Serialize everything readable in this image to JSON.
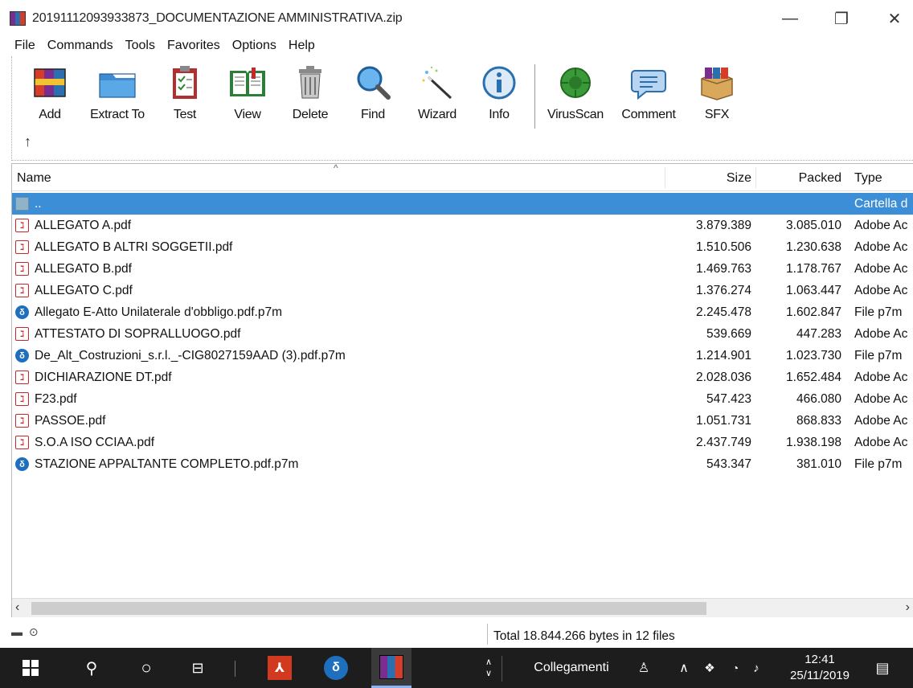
{
  "window": {
    "title": "20191112093933873_DOCUMENTAZIONE AMMINISTRATIVA.zip",
    "min_glyph": "—",
    "max_glyph": "❐",
    "close_glyph": "✕"
  },
  "menu": [
    "File",
    "Commands",
    "Tools",
    "Favorites",
    "Options",
    "Help"
  ],
  "toolbar": {
    "add": "Add",
    "extract": "Extract To",
    "test": "Test",
    "view": "View",
    "delete": "Delete",
    "find": "Find",
    "wizard": "Wizard",
    "info": "Info",
    "virusscan": "VirusScan",
    "comment": "Comment",
    "sfx": "SFX",
    "up_glyph": "↑"
  },
  "columns": {
    "name": "Name",
    "size": "Size",
    "packed": "Packed",
    "type": "Type"
  },
  "rows": [
    {
      "icon": "folder-up-icon",
      "name": "..",
      "size": "",
      "packed": "",
      "type": "Cartella d"
    },
    {
      "icon": "pdf-icon",
      "name": "ALLEGATO A.pdf",
      "size": "3.879.389",
      "packed": "3.085.010",
      "type": "Adobe Ac"
    },
    {
      "icon": "pdf-icon",
      "name": "ALLEGATO B ALTRI SOGGETII.pdf",
      "size": "1.510.506",
      "packed": "1.230.638",
      "type": "Adobe Ac"
    },
    {
      "icon": "pdf-icon",
      "name": "ALLEGATO B.pdf",
      "size": "1.469.763",
      "packed": "1.178.767",
      "type": "Adobe Ac"
    },
    {
      "icon": "pdf-icon",
      "name": "ALLEGATO C.pdf",
      "size": "1.376.274",
      "packed": "1.063.447",
      "type": "Adobe Ac"
    },
    {
      "icon": "p7m-icon",
      "name": "Allegato E-Atto Unilaterale d'obbligo.pdf.p7m",
      "size": "2.245.478",
      "packed": "1.602.847",
      "type": "File p7m"
    },
    {
      "icon": "pdf-icon",
      "name": "ATTESTATO DI SOPRALLUOGO.pdf",
      "size": "539.669",
      "packed": "447.283",
      "type": "Adobe Ac"
    },
    {
      "icon": "p7m-icon",
      "name": "De_Alt_Costruzioni_s.r.l._-CIG8027159AAD (3).pdf.p7m",
      "size": "1.214.901",
      "packed": "1.023.730",
      "type": "File p7m"
    },
    {
      "icon": "pdf-icon",
      "name": "DICHIARAZIONE DT.pdf",
      "size": "2.028.036",
      "packed": "1.652.484",
      "type": "Adobe Ac"
    },
    {
      "icon": "pdf-icon",
      "name": "F23.pdf",
      "size": "547.423",
      "packed": "466.080",
      "type": "Adobe Ac"
    },
    {
      "icon": "pdf-icon",
      "name": "PASSOE.pdf",
      "size": "1.051.731",
      "packed": "868.833",
      "type": "Adobe Ac"
    },
    {
      "icon": "pdf-icon",
      "name": "S.O.A ISO CCIAA.pdf",
      "size": "2.437.749",
      "packed": "1.938.198",
      "type": "Adobe Ac"
    },
    {
      "icon": "p7m-icon",
      "name": "STAZIONE APPALTANTE COMPLETO.pdf.p7m",
      "size": "543.347",
      "packed": "381.010",
      "type": "File p7m"
    }
  ],
  "status": {
    "total": "Total 18.844.266 bytes in 12 files"
  },
  "taskbar": {
    "links": "Collegamenti",
    "time": "12:41",
    "date": "25/11/2019"
  },
  "colors": {
    "selection": "#3c8fd6",
    "taskbar": "#1d1d1d",
    "pdf": "#c62828",
    "p7m": "#1f6fbf"
  }
}
